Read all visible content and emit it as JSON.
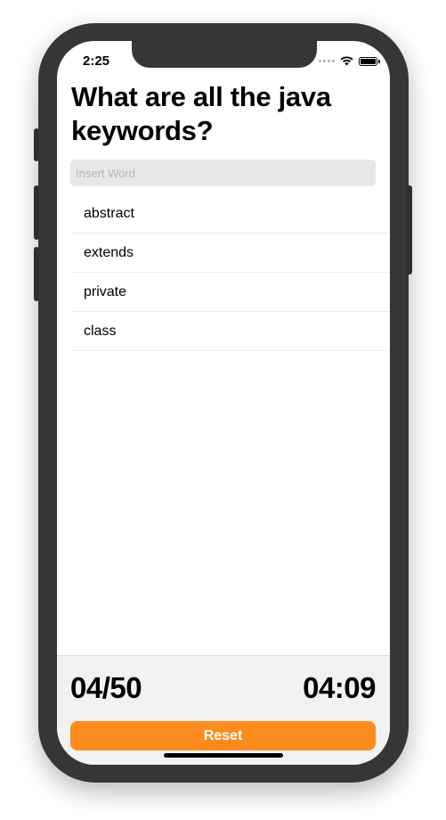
{
  "status_bar": {
    "time": "2:25",
    "icons": [
      "signal-dots-icon",
      "wifi-icon",
      "battery-icon"
    ]
  },
  "quiz": {
    "title": "What are all the java keywords?"
  },
  "search": {
    "placeholder": "Insert Word",
    "value": ""
  },
  "answers": [
    {
      "label": "abstract"
    },
    {
      "label": "extends"
    },
    {
      "label": "private"
    },
    {
      "label": "class"
    }
  ],
  "footer": {
    "score": "04/50",
    "timer": "04:09",
    "reset_label": "Reset"
  },
  "colors": {
    "accent": "#fd8c1f",
    "device_frame": "#363636",
    "footer_background": "#f2f2f2",
    "search_background": "#e8e8e8"
  }
}
